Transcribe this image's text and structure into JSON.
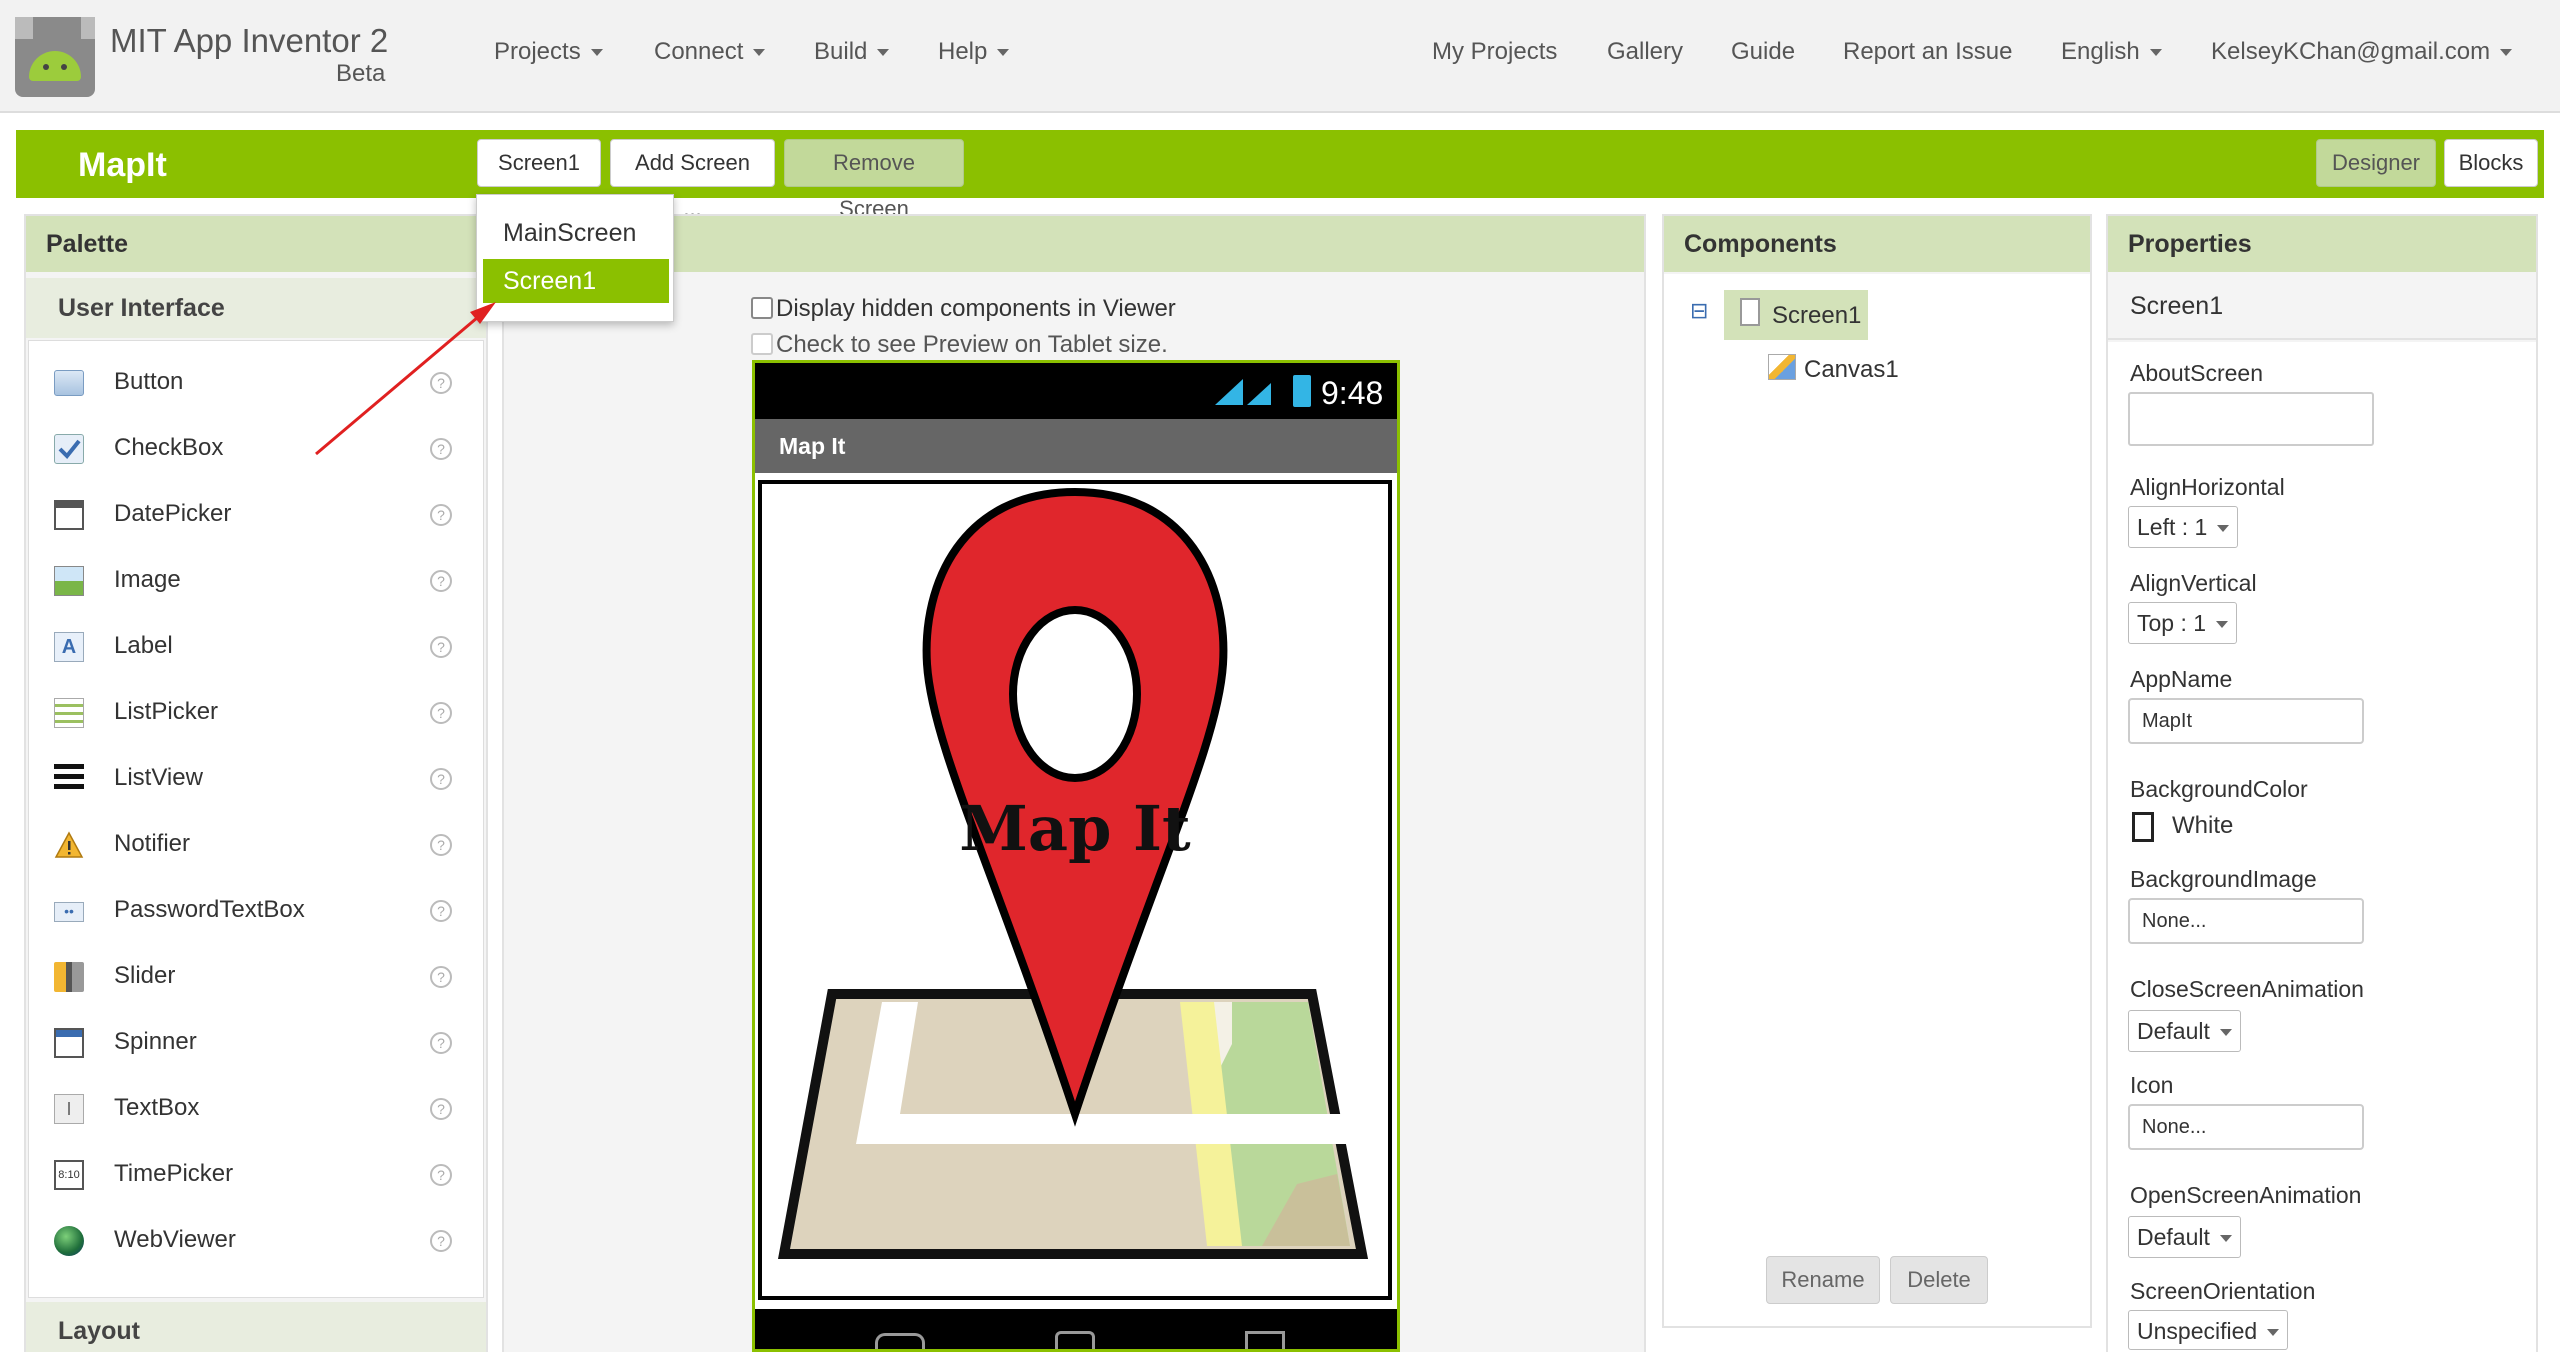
{
  "header": {
    "brand": "MIT App Inventor 2",
    "beta": "Beta",
    "menus": [
      "Projects",
      "Connect",
      "Build",
      "Help"
    ],
    "links": [
      "My Projects",
      "Gallery",
      "Guide",
      "Report an Issue"
    ],
    "language": "English",
    "user": "KelseyKChan@gmail.com"
  },
  "toolbar": {
    "project_name": "MapIt",
    "screen_select": "Screen1",
    "add_screen": "Add Screen ...",
    "remove_screen": "Remove Screen",
    "designer": "Designer",
    "blocks": "Blocks"
  },
  "screen_dropdown": {
    "options": [
      "MainScreen",
      "Screen1"
    ],
    "selected": "Screen1"
  },
  "palette": {
    "title": "Palette",
    "category": "User Interface",
    "items": [
      "Button",
      "CheckBox",
      "DatePicker",
      "Image",
      "Label",
      "ListPicker",
      "ListView",
      "Notifier",
      "PasswordTextBox",
      "Slider",
      "Spinner",
      "TextBox",
      "TimePicker",
      "WebViewer"
    ],
    "help_glyph": "?",
    "next_category": "Layout"
  },
  "viewer": {
    "hidden_components_label": "Display hidden components in Viewer",
    "tablet_label": "Check to see Preview on Tablet size.",
    "phone_time": "9:48",
    "app_title": "Map It",
    "pin_text": "Map It"
  },
  "components": {
    "title": "Components",
    "tree": [
      "Screen1",
      "Canvas1"
    ],
    "collapse_glyph": "⊟",
    "rename": "Rename",
    "delete": "Delete"
  },
  "properties": {
    "title": "Properties",
    "component": "Screen1",
    "about_label": "AboutScreen",
    "align_h_label": "AlignHorizontal",
    "align_h_value": "Left : 1",
    "align_v_label": "AlignVertical",
    "align_v_value": "Top : 1",
    "appname_label": "AppName",
    "appname_value": "MapIt",
    "bgcolor_label": "BackgroundColor",
    "bgcolor_value": "White",
    "bgimage_label": "BackgroundImage",
    "bgimage_value": "None...",
    "close_anim_label": "CloseScreenAnimation",
    "close_anim_value": "Default",
    "icon_label": "Icon",
    "icon_value": "None...",
    "open_anim_label": "OpenScreenAnimation",
    "open_anim_value": "Default",
    "orientation_label": "ScreenOrientation",
    "orientation_value": "Unspecified"
  },
  "colors": {
    "accent": "#8bc000",
    "panel_header": "#d3e2b9",
    "pin_red": "#e0262c",
    "annotation_arrow": "#e02020"
  }
}
